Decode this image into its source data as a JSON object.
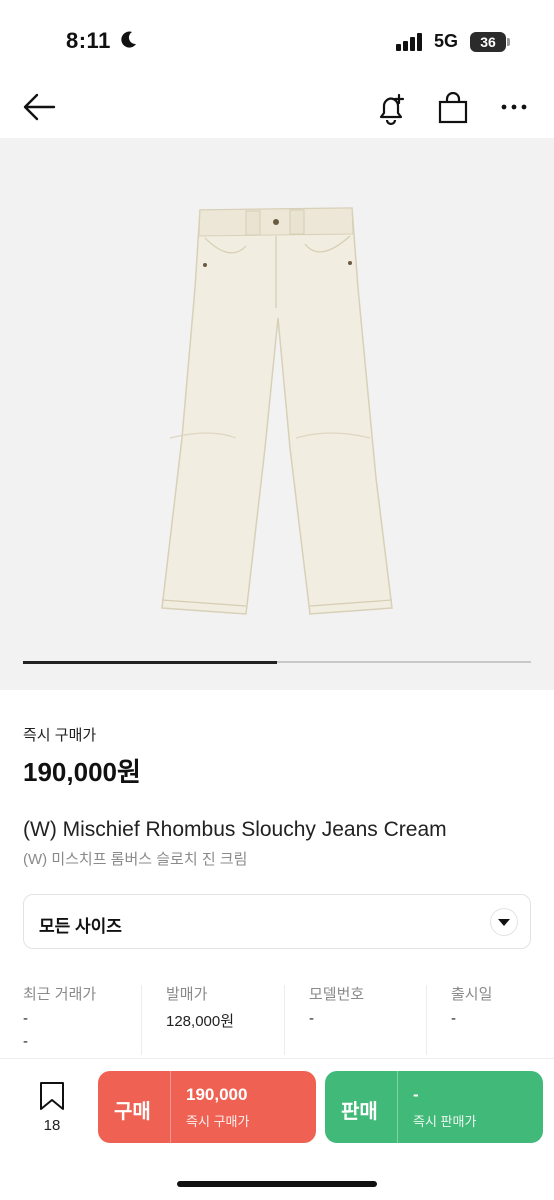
{
  "status_bar": {
    "time": "8:11",
    "network": "5G",
    "battery": "36"
  },
  "nav": {
    "back_icon": "arrow-left-icon",
    "alert_icon": "bell-plus-icon",
    "bag_icon": "shopping-bag-icon",
    "more_icon": "more-horizontal-icon"
  },
  "gallery": {
    "image_alt": "cream jeans",
    "progress": 0.5
  },
  "price": {
    "label": "즉시 구매가",
    "value": "190,000원"
  },
  "product": {
    "title_en": "(W) Mischief Rhombus Slouchy Jeans Cream",
    "title_ko": "(W) 미스치프 롬버스 슬로치 진 크림"
  },
  "size_select": {
    "value": "모든 사이즈"
  },
  "info": [
    {
      "header": "최근 거래가",
      "value": "-",
      "value2": "-"
    },
    {
      "header": "발매가",
      "value": "128,000원"
    },
    {
      "header": "모델번호",
      "value": "-"
    },
    {
      "header": "출시일",
      "value": "-"
    }
  ],
  "bottom": {
    "bookmark_count": "18",
    "buy": {
      "label": "구매",
      "price": "190,000",
      "sub": "즉시 구매가"
    },
    "sell": {
      "label": "판매",
      "price": "-",
      "sub": "즉시 판매가"
    }
  },
  "colors": {
    "buy": "#ef6253",
    "sell": "#41b979"
  }
}
